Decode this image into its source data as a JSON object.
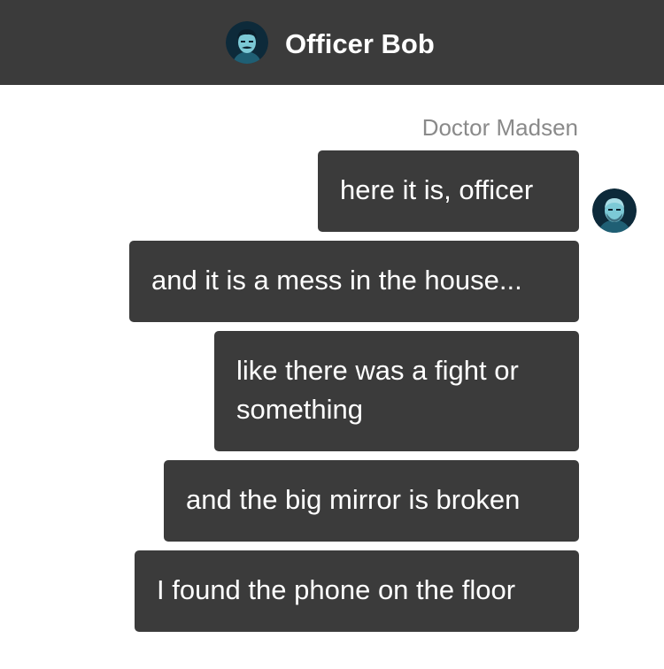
{
  "header": {
    "title": "Officer Bob",
    "avatar_icon": "officer-portrait"
  },
  "conversation": {
    "sender_name": "Doctor Madsen",
    "sender_avatar_icon": "doctor-portrait",
    "messages": [
      {
        "text": "here it is, officer"
      },
      {
        "text": "and it is a mess in the house..."
      },
      {
        "text": "like there was a fight or something"
      },
      {
        "text": "and the big mirror is broken"
      },
      {
        "text": "I found the phone on the floor"
      }
    ]
  },
  "colors": {
    "header_bg": "#3b3b3b",
    "bubble_bg": "#3b3b3b",
    "bubble_text": "#ffffff",
    "sender_name": "#8a8a8a",
    "avatar_accent": "#5fb8c9"
  }
}
